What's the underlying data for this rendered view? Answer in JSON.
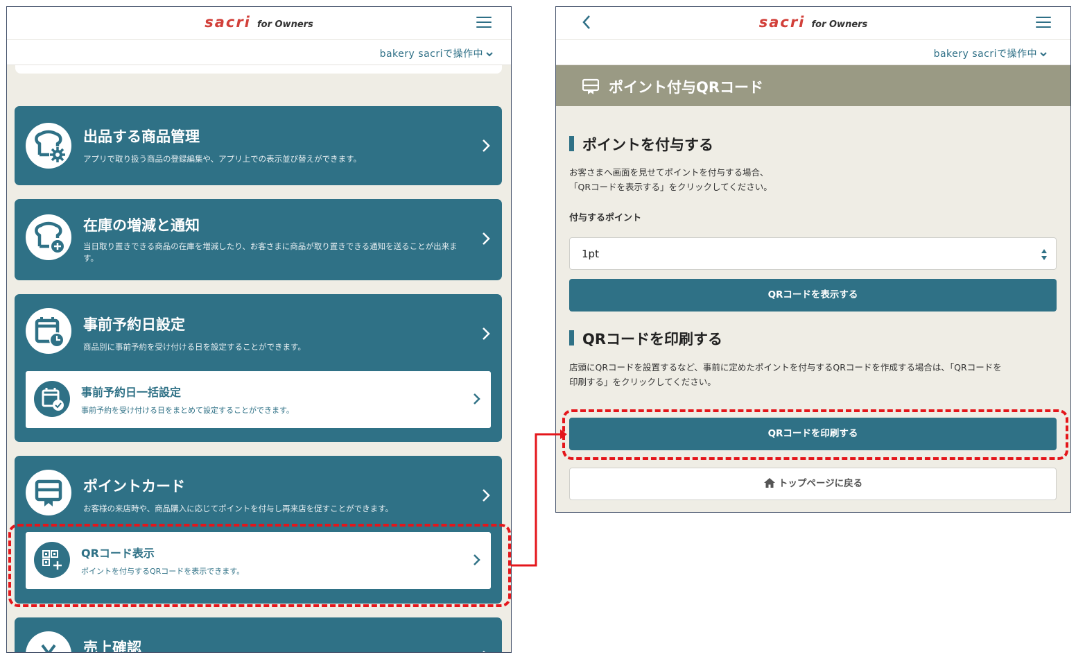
{
  "app": {
    "logo_main": "sacri",
    "logo_sub": "for Owners",
    "operating_as": "bakery sacriで操作中"
  },
  "left_screen": {
    "cards": [
      {
        "title": "出品する商品管理",
        "description": "アプリで取り扱う商品の登録編集や、アプリ上での表示並び替えができます。",
        "icon": "bread-gear-icon"
      },
      {
        "title": "在庫の増減と通知",
        "description": "当日取り置きできる商品の在庫を増減したり、お客さまに商品が取り置きできる通知を送ることが出来ます。",
        "icon": "bread-plus-icon"
      },
      {
        "title": "事前予約日設定",
        "description": "商品別に事前予約を受け付ける日を設定することができます。",
        "icon": "calendar-clock-icon",
        "sub_item": {
          "title": "事前予約日一括設定",
          "description": "事前予約を受け付ける日をまとめて設定することができます。",
          "icon": "calendar-check-icon"
        }
      },
      {
        "title": "ポイントカード",
        "description": "お客様の来店時や、商品購入に応じてポイントを付与し再来店を促すことができます。",
        "icon": "point-card-icon",
        "sub_item": {
          "title": "QRコード表示",
          "description": "ポイントを付与するQRコードを表示できます。",
          "icon": "qr-plus-icon"
        }
      },
      {
        "title": "売上確認",
        "icon": "yen-icon"
      }
    ]
  },
  "right_screen": {
    "page_title": "ポイント付与QRコード",
    "section1": {
      "title": "ポイントを付与する",
      "description_line1": "お客さまへ画面を見せてポイントを付与する場合、",
      "description_line2": "「QRコードを表示する」をクリックしてください。",
      "field_label": "付与するポイント",
      "select_value": "1pt",
      "button_label": "QRコードを表示する"
    },
    "section2": {
      "title": "QRコードを印刷する",
      "description_line1": "店頭にQRコードを設置するなど、事前に定めたポイントを付与するQRコードを作成する場合は、「QRコードを",
      "description_line2": "印刷する」をクリックしてください。",
      "button_label": "QRコードを印刷する"
    },
    "back_button_label": "トップページに戻る"
  },
  "colors": {
    "brand_red": "#d2403a",
    "teal": "#2f7186",
    "header_olive": "#9a9a84",
    "page_bg": "#efede5",
    "highlight_red": "#e4161b"
  }
}
